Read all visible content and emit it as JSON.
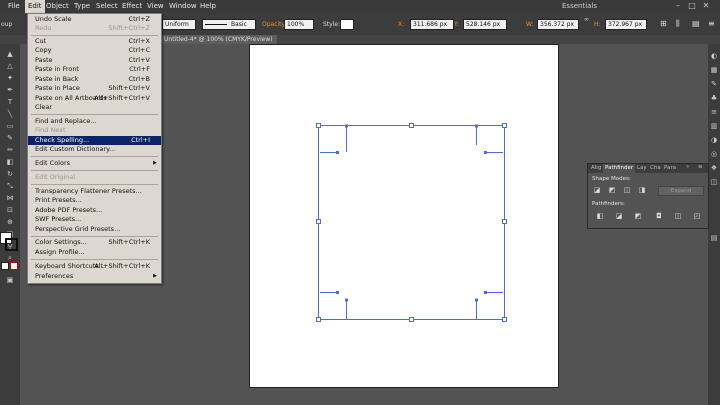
{
  "menubar": {
    "items": [
      "File",
      "Edit",
      "Object",
      "Type",
      "Select",
      "Effect",
      "View",
      "Window",
      "Help"
    ],
    "workspace": "Essentials"
  },
  "control": {
    "mode_label": "oup",
    "stroke_profile": "Uniform",
    "brush": "Basic",
    "opacity_label": "Opacity:",
    "opacity_value": "100%",
    "style_label": "Style:",
    "x_label": "X:",
    "x_value": "311.686 px",
    "y_label": "Y:",
    "y_value": "528.146 px",
    "w_label": "W:",
    "w_value": "356.372 px",
    "h_label": "H:",
    "h_value": "372.967 px"
  },
  "document": {
    "tab_title": "Untitled-4* @ 100% (CMYK/Preview)"
  },
  "edit_menu": {
    "items": [
      {
        "label": "Undo Scale",
        "shortcut": "Ctrl+Z",
        "disabled": false
      },
      {
        "label": "Redo",
        "shortcut": "Shift+Ctrl+Z",
        "disabled": true
      },
      {
        "label": "Cut",
        "shortcut": "Ctrl+X",
        "disabled": false
      },
      {
        "label": "Copy",
        "shortcut": "Ctrl+C",
        "disabled": false
      },
      {
        "label": "Paste",
        "shortcut": "Ctrl+V",
        "disabled": false
      },
      {
        "label": "Paste in Front",
        "shortcut": "Ctrl+F",
        "disabled": false
      },
      {
        "label": "Paste in Back",
        "shortcut": "Ctrl+B",
        "disabled": false
      },
      {
        "label": "Paste in Place",
        "shortcut": "Shift+Ctrl+V",
        "disabled": false
      },
      {
        "label": "Paste on All Artboards",
        "shortcut": "Alt+Shift+Ctrl+V",
        "disabled": false
      },
      {
        "label": "Clear",
        "shortcut": "",
        "disabled": false
      },
      {
        "label": "Find and Replace...",
        "shortcut": "",
        "disabled": false
      },
      {
        "label": "Find Next",
        "shortcut": "",
        "disabled": true
      },
      {
        "label": "Check Spelling...",
        "shortcut": "Ctrl+I",
        "disabled": false,
        "highlighted": true
      },
      {
        "label": "Edit Custom Dictionary...",
        "shortcut": "",
        "disabled": false
      },
      {
        "label": "Edit Colors",
        "shortcut": "",
        "disabled": false,
        "submenu": true
      },
      {
        "label": "Edit Original",
        "shortcut": "",
        "disabled": true
      },
      {
        "label": "Transparency Flattener Presets...",
        "shortcut": "",
        "disabled": false
      },
      {
        "label": "Print Presets...",
        "shortcut": "",
        "disabled": false
      },
      {
        "label": "Adobe PDF Presets...",
        "shortcut": "",
        "disabled": false
      },
      {
        "label": "SWF Presets...",
        "shortcut": "",
        "disabled": false
      },
      {
        "label": "Perspective Grid Presets...",
        "shortcut": "",
        "disabled": false
      },
      {
        "label": "Color Settings...",
        "shortcut": "Shift+Ctrl+K",
        "disabled": false
      },
      {
        "label": "Assign Profile...",
        "shortcut": "",
        "disabled": false
      },
      {
        "label": "Keyboard Shortcuts...",
        "shortcut": "Alt+Shift+Ctrl+K",
        "disabled": false
      },
      {
        "label": "Preferences",
        "shortcut": "",
        "disabled": false,
        "submenu": true
      }
    ]
  },
  "pathfinder_panel": {
    "tabs": [
      "Alig",
      "Pathfinder",
      "Lay",
      "Cha",
      "Para"
    ],
    "shape_modes_label": "Shape Modes:",
    "pathfinders_label": "Pathfinders:",
    "expand_label": "Expand"
  },
  "colors": {
    "menu_bg": "#dcd8d0",
    "highlight": "#0a246a",
    "selection": "#4a6fd8",
    "opacity_label": "#e09a2e"
  }
}
